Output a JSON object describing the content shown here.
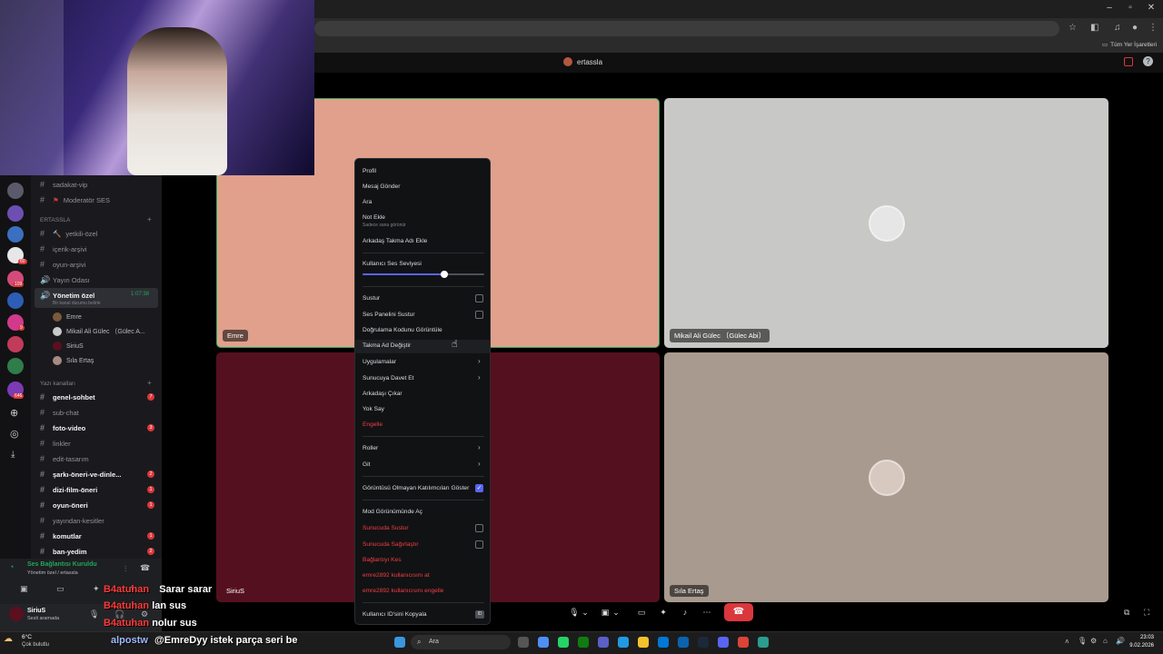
{
  "browser": {
    "bookmark_label": "Tüm Yer İşaretleri"
  },
  "header": {
    "user": "ertassla"
  },
  "sidebar": {
    "channels_top": [
      {
        "name": "sadakat-vip"
      },
      {
        "name": "Moderatör SES"
      }
    ],
    "category1": "ERTASSLA",
    "channels1": [
      {
        "name": "yetkili-özel"
      },
      {
        "name": "içerik-arşivi"
      },
      {
        "name": "oyun-arşivi"
      },
      {
        "name": "Yayın Odası"
      }
    ],
    "active_voice": {
      "name": "Yönetim özel",
      "timer": "1:07:38",
      "subtitle": "Bir kanal durumu belirle"
    },
    "voice_users": [
      {
        "name": "Emre",
        "color": "#7a5a3a"
      },
      {
        "name": "Mikail Ali Gülec 〔Gülec A...",
        "color": "#c9c9c9"
      },
      {
        "name": "SiriuS",
        "color": "#5b0f1f"
      },
      {
        "name": "Sıla Ertaş",
        "color": "#a68b82"
      }
    ],
    "category2": "Yazı kanalları",
    "text_channels": [
      {
        "name": "genel-sohbet",
        "bold": true,
        "badge": "7"
      },
      {
        "name": "sub-chat",
        "bold": false,
        "badge": ""
      },
      {
        "name": "foto-video",
        "bold": true,
        "badge": "3"
      },
      {
        "name": "linkler",
        "bold": false,
        "badge": ""
      },
      {
        "name": "edit-tasarım",
        "bold": false,
        "badge": ""
      },
      {
        "name": "şarkı-öneri-ve-dinle...",
        "bold": true,
        "badge": "2"
      },
      {
        "name": "dizi-film-öneri",
        "bold": true,
        "badge": "1"
      },
      {
        "name": "oyun-öneri",
        "bold": true,
        "badge": "1"
      },
      {
        "name": "yayından-kesitler",
        "bold": false,
        "badge": ""
      },
      {
        "name": "komutlar",
        "bold": true,
        "badge": "1"
      },
      {
        "name": "ban-yedim",
        "bold": true,
        "badge": "2"
      }
    ],
    "voice_status": "Ses Bağlantısı Kuruldu",
    "voice_location": "Yönetim özel / ertassla",
    "username": "SiriuS",
    "user_status": "Sesli aramada",
    "guild_badges": [
      "60",
      "109",
      "9",
      "646"
    ]
  },
  "stage": {
    "tiles": [
      {
        "label": "Emre",
        "bg": "#e0a08c"
      },
      {
        "label": "Mikail Ali Gülec 〔Gülec Abi〕",
        "bg": "#c8c8c6"
      },
      {
        "label": "SiriuS",
        "bg": "#55101f"
      },
      {
        "label": "Sıla Ertaş",
        "bg": "#a99a8f"
      }
    ]
  },
  "menu": {
    "items": {
      "profile": "Profil",
      "message": "Mesaj Gönder",
      "call": "Ara",
      "note": "Not Ekle",
      "note_sub": "Sadece sana görünür",
      "nickname_friend": "Arkadaş Takma Adı Ekle",
      "volume_label": "Kullanıcı Ses Seviyesi",
      "mute": "Sustur",
      "mute_soundboard": "Ses Panelini Sustur",
      "verify_code": "Doğrulama Kodunu Görüntüle",
      "change_nick": "Takma Ad Değiştir",
      "apps": "Uygulamalar",
      "invite": "Sunucuya Davet Et",
      "remove_friend": "Arkadaşı Çıkar",
      "ignore": "Yok Say",
      "block": "Engelle",
      "roles": "Roller",
      "go": "Git",
      "show_nonvideo": "Görüntüsü Olmayan Katılımcıları Göster",
      "focus_mode": "Mod Görünümünde Aç",
      "server_mute": "Sunucuda Sustur",
      "server_deafen": "Sunucuda Sağırlaştır",
      "disconnect": "Bağlantıyı Kes",
      "kick": "emre2892 kullanıcısını at",
      "ban": "emre2892 kullanıcısını engelle",
      "copy_id": "Kullanıcı ID'sini Kopyala"
    },
    "volume_fraction": 0.67
  },
  "chat": [
    {
      "name": "B4atuhan",
      "text": "Sarar sarar"
    },
    {
      "name": "B4atuhan",
      "text": "lan sus"
    },
    {
      "name": "B4atuhan",
      "text": "nolur sus"
    },
    {
      "name": "alpostw",
      "text": "@EmreDyy istek parça seri be"
    }
  ],
  "taskbar": {
    "weather_temp": "6°C",
    "weather_desc": "Çok bulutlu",
    "search_placeholder": "Ara",
    "time": "23:03",
    "date": "9.02.2026"
  }
}
